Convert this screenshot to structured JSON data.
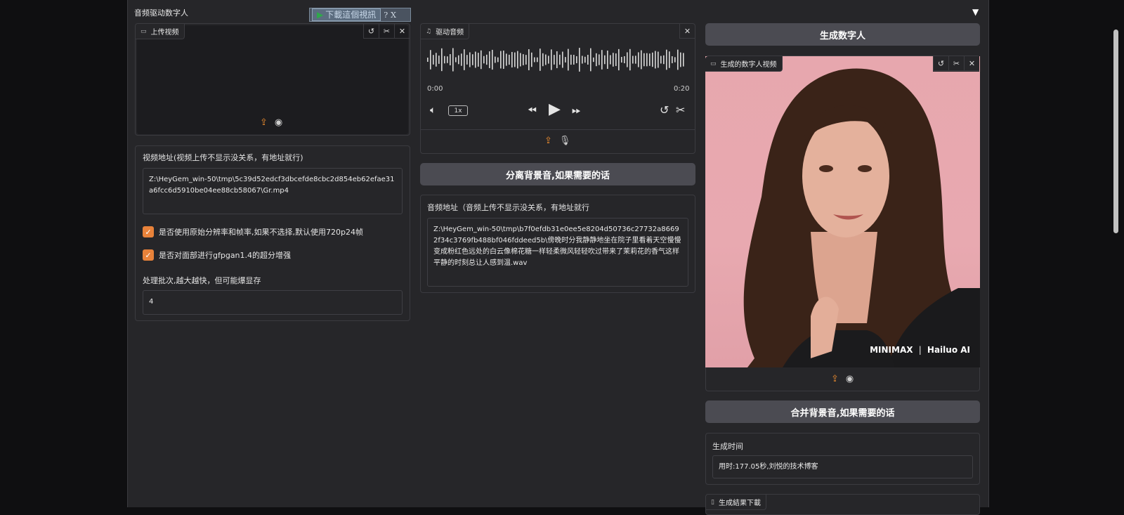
{
  "panel": {
    "title": "音频驱动数字人"
  },
  "overlay": {
    "download_label": "下載這個視訊",
    "help": "?",
    "close": "X"
  },
  "video_upload": {
    "tag": "上传视频"
  },
  "video_path": {
    "label": "视频地址(视频上传不显示没关系，有地址就行)",
    "value": "Z:\\HeyGem_win-50\\tmp\\5c39d52edcf3dbcefde8cbc2d854eb62efae31a6fcc6d5910be04ee88cb58067\\Gr.mp4"
  },
  "options": {
    "original_resolution": "是否使用原始分辨率和帧率,如果不选择,默认使用720p24帧",
    "gfpgan": "是否对面部进行gfpgan1.4的超分增强"
  },
  "batch": {
    "label": "处理批次,越大越快，但可能爆显存",
    "value": "4"
  },
  "audio": {
    "tag": "驱动音频",
    "time_start": "0:00",
    "time_end": "0:20",
    "speed": "1x"
  },
  "separate_button": "分离背景音,如果需要的话",
  "audio_path": {
    "label": "音频地址（音频上传不显示没关系，有地址就行",
    "value": "Z:\\HeyGem_win-50\\tmp\\b7f0efdb31e0ee5e8204d50736c27732a86692f34c3769fb488bf046fddeed5b\\傍晚时分我静静地坐在院子里看着天空慢慢变成粉红色远处的白云像棉花糖一样轻柔微风轻轻吹过带来了茉莉花的香气这样平静的时刻总让人感到温.wav"
  },
  "generate_button": "生成数字人",
  "output_video": {
    "tag": "生成的数字人视频",
    "watermark_brand1": "MINIMAX",
    "watermark_brand2": "Hailuo AI"
  },
  "merge_button": "合并背景音,如果需要的话",
  "gen_time": {
    "label": "生成时间",
    "value": "用时:177.05秒,刘悦的技术博客"
  },
  "download": {
    "tag": "生成結果下載"
  }
}
